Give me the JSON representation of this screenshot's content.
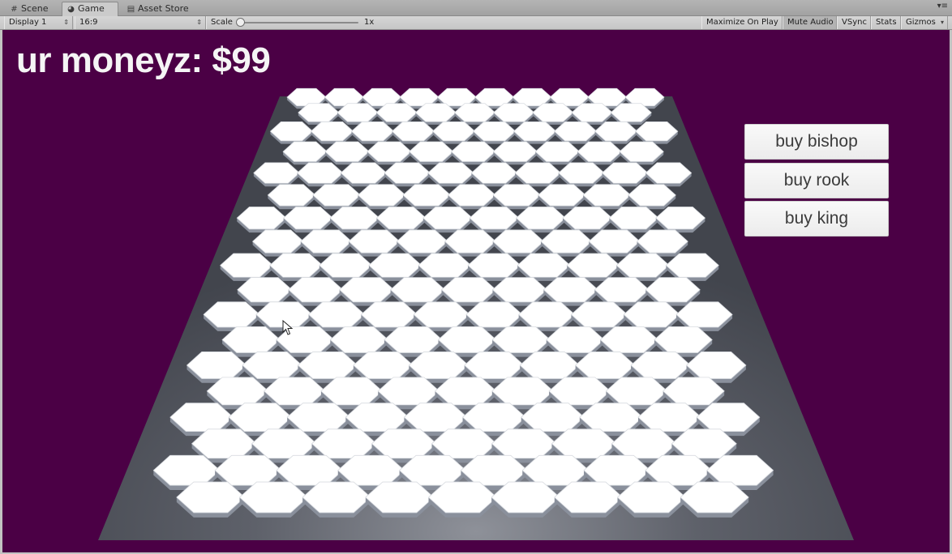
{
  "tabs": [
    {
      "label": "Scene",
      "icon": "grid-icon"
    },
    {
      "label": "Game",
      "icon": "pacman-icon",
      "active": true
    },
    {
      "label": "Asset Store",
      "icon": "store-icon"
    }
  ],
  "toolbar": {
    "display": "Display 1",
    "aspect": "16:9",
    "scale_label": "Scale",
    "scale_value": "1x",
    "maximize_on_play": "Maximize On Play",
    "mute_audio": "Mute Audio",
    "vsync": "VSync",
    "stats": "Stats",
    "gizmos": "Gizmos"
  },
  "game": {
    "money_text": "ur moneyz: $99",
    "buttons": [
      "buy bishop",
      "buy rook",
      "buy king"
    ],
    "colors": {
      "background": "#4b0045",
      "board": "#4a4d55",
      "tile_top": "#ffffff",
      "tile_edge": "#8a909c",
      "money_text": "#f5f5f5"
    }
  }
}
